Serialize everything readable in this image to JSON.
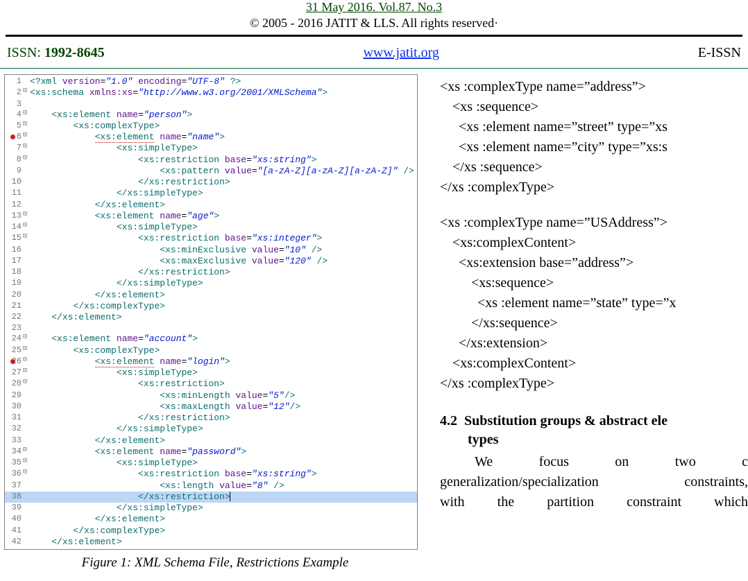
{
  "header": {
    "dateline": "31  May 2016. Vol.87. No.3",
    "copyright": "© 2005 - 2016 JATIT & LLS. All rights reserved·",
    "issn_label": "ISSN:",
    "issn_value": "1992-8645",
    "link": "www.jatit.org",
    "eissn_label": "E-ISSN"
  },
  "code": {
    "lines": [
      {
        "n": 1,
        "fold": "",
        "html": "<span class='tag'>&lt;?xml</span> <span class='attr'>version</span>=<span class='val'>\"1.0\"</span> <span class='attr'>encoding</span>=<span class='val'>\"UTF-8\"</span> <span class='tag'>?&gt;</span>"
      },
      {
        "n": 2,
        "fold": "⊟",
        "html": "<span class='tag'>&lt;xs:schema</span> <span class='attr'>xmlns:xs</span>=<span class='val'>\"http://www.w3.org/2001/XMLSchema\"</span><span class='tag'>&gt;</span>"
      },
      {
        "n": 3,
        "fold": "",
        "html": ""
      },
      {
        "n": 4,
        "fold": "⊟",
        "html": "    <span class='tag'>&lt;xs:element</span> <span class='attr'>name</span>=<span class='val'>\"person\"</span><span class='tag'>&gt;</span>"
      },
      {
        "n": 5,
        "fold": "⊟",
        "html": "        <span class='tag'>&lt;xs:complexType&gt;</span>"
      },
      {
        "n": 6,
        "fold": "⊟",
        "reddot": true,
        "html": "            <span class='tag hl-red-dash'>&lt;xs:element</span> <span class='attr'>name</span>=<span class='val'>\"name\"</span><span class='tag'>&gt;</span>"
      },
      {
        "n": 7,
        "fold": "⊟",
        "html": "                <span class='tag'>&lt;xs:simpleType&gt;</span>"
      },
      {
        "n": 8,
        "fold": "⊟",
        "html": "                    <span class='tag'>&lt;xs:restriction</span> <span class='attr'>base</span>=<span class='val'>\"xs:string\"</span><span class='tag'>&gt;</span>"
      },
      {
        "n": 9,
        "fold": "",
        "html": "                        <span class='tag'>&lt;xs:pattern</span> <span class='attr'>value</span>=<span class='val'>\"[a-zA-Z][a-zA-Z][a-zA-Z]\"</span> <span class='tag'>/&gt;</span>"
      },
      {
        "n": 10,
        "fold": "",
        "html": "                    <span class='tag'>&lt;/xs:restriction&gt;</span>"
      },
      {
        "n": 11,
        "fold": "",
        "html": "                <span class='tag'>&lt;/xs:simpleType&gt;</span>"
      },
      {
        "n": 12,
        "fold": "",
        "html": "            <span class='tag'>&lt;/xs:element&gt;</span>"
      },
      {
        "n": 13,
        "fold": "⊟",
        "html": "            <span class='tag'>&lt;xs:element</span> <span class='attr'>name</span>=<span class='val'>\"age\"</span><span class='tag'>&gt;</span>"
      },
      {
        "n": 14,
        "fold": "⊟",
        "html": "                <span class='tag'>&lt;xs:simpleType&gt;</span>"
      },
      {
        "n": 15,
        "fold": "⊟",
        "html": "                    <span class='tag'>&lt;xs:restriction</span> <span class='attr'>base</span>=<span class='val'>\"xs:integer\"</span><span class='tag'>&gt;</span>"
      },
      {
        "n": 16,
        "fold": "",
        "html": "                        <span class='tag'>&lt;xs:minExclusive</span> <span class='attr'>value</span>=<span class='val'>\"10\"</span> <span class='tag'>/&gt;</span>"
      },
      {
        "n": 17,
        "fold": "",
        "html": "                        <span class='tag'>&lt;xs:maxExclusive</span> <span class='attr'>value</span>=<span class='val'>\"120\"</span> <span class='tag'>/&gt;</span>"
      },
      {
        "n": 18,
        "fold": "",
        "html": "                    <span class='tag'>&lt;/xs:restriction&gt;</span>"
      },
      {
        "n": 19,
        "fold": "",
        "html": "                <span class='tag'>&lt;/xs:simpleType&gt;</span>"
      },
      {
        "n": 20,
        "fold": "",
        "html": "            <span class='tag'>&lt;/xs:element&gt;</span>"
      },
      {
        "n": 21,
        "fold": "",
        "html": "        <span class='tag'>&lt;/xs:complexType&gt;</span>"
      },
      {
        "n": 22,
        "fold": "",
        "html": "    <span class='tag'>&lt;/xs:element&gt;</span>"
      },
      {
        "n": 23,
        "fold": "",
        "html": ""
      },
      {
        "n": 24,
        "fold": "⊟",
        "html": "    <span class='tag'>&lt;xs:element</span> <span class='attr'>name</span>=<span class='val'>\"account\"</span><span class='tag'>&gt;</span>"
      },
      {
        "n": 25,
        "fold": "⊟",
        "html": "        <span class='tag'>&lt;xs:complexType&gt;</span>"
      },
      {
        "n": 26,
        "fold": "⊟",
        "reddot": true,
        "html": "            <span class='tag hl-red-dash'>&lt;xs:element</span> <span class='attr'>name</span>=<span class='val'>\"login\"</span><span class='tag'>&gt;</span>"
      },
      {
        "n": 27,
        "fold": "⊟",
        "html": "                <span class='tag'>&lt;xs:simpleType&gt;</span>"
      },
      {
        "n": 28,
        "fold": "⊟",
        "html": "                    <span class='tag'>&lt;xs:restriction&gt;</span>"
      },
      {
        "n": 29,
        "fold": "",
        "html": "                        <span class='tag'>&lt;xs:minLength</span> <span class='attr'>value</span>=<span class='val'>\"5\"</span><span class='tag'>/&gt;</span>"
      },
      {
        "n": 30,
        "fold": "",
        "html": "                        <span class='tag'>&lt;xs:maxLength</span> <span class='attr'>value</span>=<span class='val'>\"12\"</span><span class='tag'>/&gt;</span>"
      },
      {
        "n": 31,
        "fold": "",
        "html": "                    <span class='tag'>&lt;/xs:restriction&gt;</span>"
      },
      {
        "n": 32,
        "fold": "",
        "html": "                <span class='tag'>&lt;/xs:simpleType&gt;</span>"
      },
      {
        "n": 33,
        "fold": "",
        "html": "            <span class='tag'>&lt;/xs:element&gt;</span>"
      },
      {
        "n": 34,
        "fold": "⊟",
        "html": "            <span class='tag'>&lt;xs:element</span> <span class='attr'>name</span>=<span class='val'>\"password\"</span><span class='tag'>&gt;</span>"
      },
      {
        "n": 35,
        "fold": "⊟",
        "html": "                <span class='tag'>&lt;xs:simpleType&gt;</span>"
      },
      {
        "n": 36,
        "fold": "⊟",
        "html": "                    <span class='tag'>&lt;xs:restriction</span> <span class='attr'>base</span>=<span class='val'>\"xs:string\"</span><span class='tag'>&gt;</span>"
      },
      {
        "n": 37,
        "fold": "",
        "html": "                        <span class='tag'>&lt;xs:length</span> <span class='attr'>value</span>=<span class='val'>\"8\"</span> <span class='tag'>/&gt;</span>"
      },
      {
        "n": 38,
        "fold": "",
        "hl": true,
        "html": "                    <span class='tag'>&lt;/xs:restriction&gt;</span><span class='cursor'></span>"
      },
      {
        "n": 39,
        "fold": "",
        "html": "                <span class='tag'>&lt;/xs:simpleType&gt;</span>"
      },
      {
        "n": 40,
        "fold": "",
        "html": "            <span class='tag'>&lt;/xs:element&gt;</span>"
      },
      {
        "n": 41,
        "fold": "",
        "html": "        <span class='tag'>&lt;/xs:complexType&gt;</span>"
      },
      {
        "n": 42,
        "fold": "",
        "html": "    <span class='tag'>&lt;/xs:element&gt;</span>"
      }
    ]
  },
  "figure_caption": "Figure 1: XML Schema File, Restrictions Example",
  "right": {
    "snippet1": [
      "<xs :complexType name=”address”>",
      "  <xs :sequence>",
      "   <xs :element name=”street” type=”xs",
      "   <xs :element name=”city” type=”xs:s",
      "  </xs :sequence>",
      "</xs :complexType>"
    ],
    "snippet2": [
      "<xs :complexType name=”USAddress”>",
      "  <xs:complexContent>",
      "   <xs:extension base=”address”>",
      "     <xs:sequence>",
      "      <xs :element name=”state” type=”x",
      "     </xs:sequence>",
      "   </xs:extension>",
      "  <xs:complexContent>",
      "</xs :complexType>"
    ],
    "section_number": "4.2",
    "section_title_line1": "Substitution groups & abstract ele",
    "section_title_line2": "types",
    "body_line1": "We     focus     on     two     c",
    "body_line2": "generalization/specialization constraints,",
    "body_line3": "with   the   partition   constraint   which"
  }
}
